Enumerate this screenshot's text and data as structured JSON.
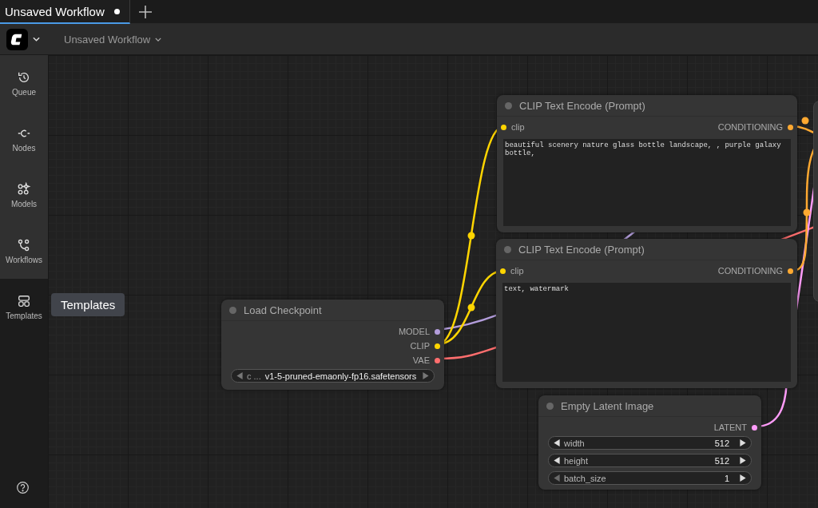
{
  "tabs": [
    {
      "label": "Unsaved Workflow",
      "selected": true,
      "unsaved": true
    }
  ],
  "menu": {
    "workflow_title": "Unsaved Workflow"
  },
  "sidebar": {
    "items": [
      {
        "kind": "queue",
        "label": "Queue",
        "selected": false
      },
      {
        "kind": "nodes",
        "label": "Nodes",
        "selected": false
      },
      {
        "kind": "models",
        "label": "Models",
        "selected": false
      },
      {
        "kind": "workflows",
        "label": "Workflows",
        "selected": false
      },
      {
        "kind": "templates",
        "label": "Templates",
        "selected": true
      }
    ]
  },
  "tooltip": "Templates",
  "nodes": [
    {
      "title": "Load Checkpoint",
      "outputs": [
        {
          "label": "MODEL",
          "color": "#b39ddb"
        },
        {
          "label": "CLIP",
          "color": "#ffd500"
        },
        {
          "label": "VAE",
          "color": "#ff6e6e"
        }
      ],
      "widgets": [
        {
          "kind": "combo",
          "label": "c ...",
          "value": "v1-5-pruned-emaonly-fp16.safetensors"
        }
      ]
    },
    {
      "title": "CLIP Text Encode (Prompt)",
      "inputs": [
        {
          "label": "clip",
          "color": "#ffd500"
        }
      ],
      "outputs": [
        {
          "label": "CONDITIONING",
          "color": "#ffa931"
        }
      ],
      "widgets": [
        {
          "kind": "text",
          "value": "beautiful scenery nature glass bottle landscape, , purple galaxy bottle,"
        }
      ]
    },
    {
      "title": "CLIP Text Encode (Prompt)",
      "inputs": [
        {
          "label": "clip",
          "color": "#ffd500"
        }
      ],
      "outputs": [
        {
          "label": "CONDITIONING",
          "color": "#ffa931"
        }
      ],
      "widgets": [
        {
          "kind": "text",
          "value": "text, watermark"
        }
      ]
    },
    {
      "title": "Empty Latent Image",
      "outputs": [
        {
          "label": "LATENT",
          "color": "#ff9cf9"
        }
      ],
      "widgets": [
        {
          "kind": "number",
          "label": "width",
          "value": "512",
          "at_minimum": false
        },
        {
          "kind": "number",
          "label": "height",
          "value": "512",
          "at_minimum": false
        },
        {
          "kind": "number",
          "label": "batch_size",
          "value": "1",
          "at_minimum": true
        }
      ]
    }
  ]
}
